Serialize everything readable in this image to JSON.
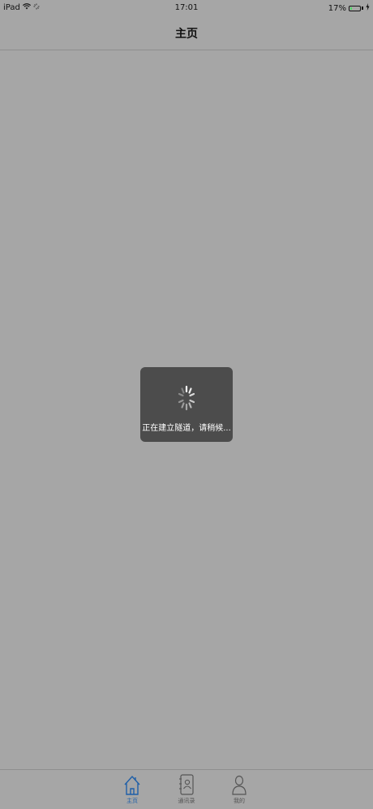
{
  "status_bar": {
    "device": "iPad",
    "time": "17:01",
    "battery": "17%",
    "battery_fraction": 0.17
  },
  "nav": {
    "title": "主页"
  },
  "loading": {
    "message": "正在建立隧道，请稍候..."
  },
  "tabs": [
    {
      "label": "主页",
      "icon": "home-icon",
      "active": true
    },
    {
      "label": "通讯录",
      "icon": "contacts-icon",
      "active": false
    },
    {
      "label": "我的",
      "icon": "person-icon",
      "active": false
    }
  ],
  "colors": {
    "background": "#a6a6a6",
    "hud": "#4c4c4c",
    "active_tab": "#1f5fa8",
    "battery": "#4cd964"
  }
}
